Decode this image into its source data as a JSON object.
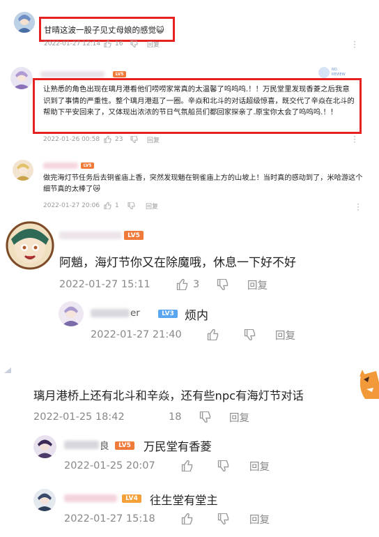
{
  "comments": [
    {
      "text": "甘晴这波一股子见丈母娘的感觉",
      "emoji": "😺",
      "time": "2022-01-27 12:14",
      "likes": "16",
      "reply": "回复"
    },
    {
      "level": "LV5",
      "text": "让熟悉的角色出现在璃月港看他们唠唠家常真的太温馨了呜呜呜.！！万民堂里发现香菱之后我意识到了事情的严重性。整个璃月港逛了一圈。辛焱和北斗的对话超级惊喜，既交代了辛焱在北斗的帮助下平安回来了，又体现出浓浓的节日气氛船员们都回家探亲了.原宝你太会了呜呜呜.！！",
      "time": "2022-01-26 00:58",
      "likes": "23",
      "reply": "回复",
      "side_badge": "NO. REVIEW"
    },
    {
      "level": "LV5",
      "text": "做完海灯节任务后去铜雀庙上香，突然发现魈在铜雀庙上方的山坡上！当时真的感动到了，米哈游这个细节真的太棒了",
      "emoji": "😿",
      "time": "2022-01-27 20:06",
      "likes": "1",
      "reply": "回复"
    },
    {
      "level": "LV5",
      "text": "阿魈，海灯节你又在除魔哦，休息一下好不好",
      "time": "2022-01-27 15:11",
      "likes": "3",
      "reply": "回复",
      "replies": [
        {
          "name_suffix": "er",
          "level": "LV3",
          "text": "烦内",
          "time": "2022-01-27 21:40",
          "reply": "回复"
        }
      ]
    },
    {
      "text": "璃月港桥上还有北斗和辛焱，还有些npc有海灯节对话",
      "time": "2022-01-25 18:42",
      "likes": "18",
      "reply": "回复",
      "replies": [
        {
          "name_suffix": "良",
          "level": "LV5",
          "text": "万民堂有香菱",
          "time": "2022-01-25 20:07",
          "reply": "回复"
        },
        {
          "level": "LV4",
          "text": "往生堂有堂主",
          "time": "2022-01-27 15:18",
          "reply": "回复"
        }
      ]
    }
  ],
  "colors": {
    "accent_red": "#e52222",
    "lv5": "#f07a3a",
    "lv4": "#f4a13a",
    "lv3": "#5aa6f0",
    "meta": "#999999"
  }
}
